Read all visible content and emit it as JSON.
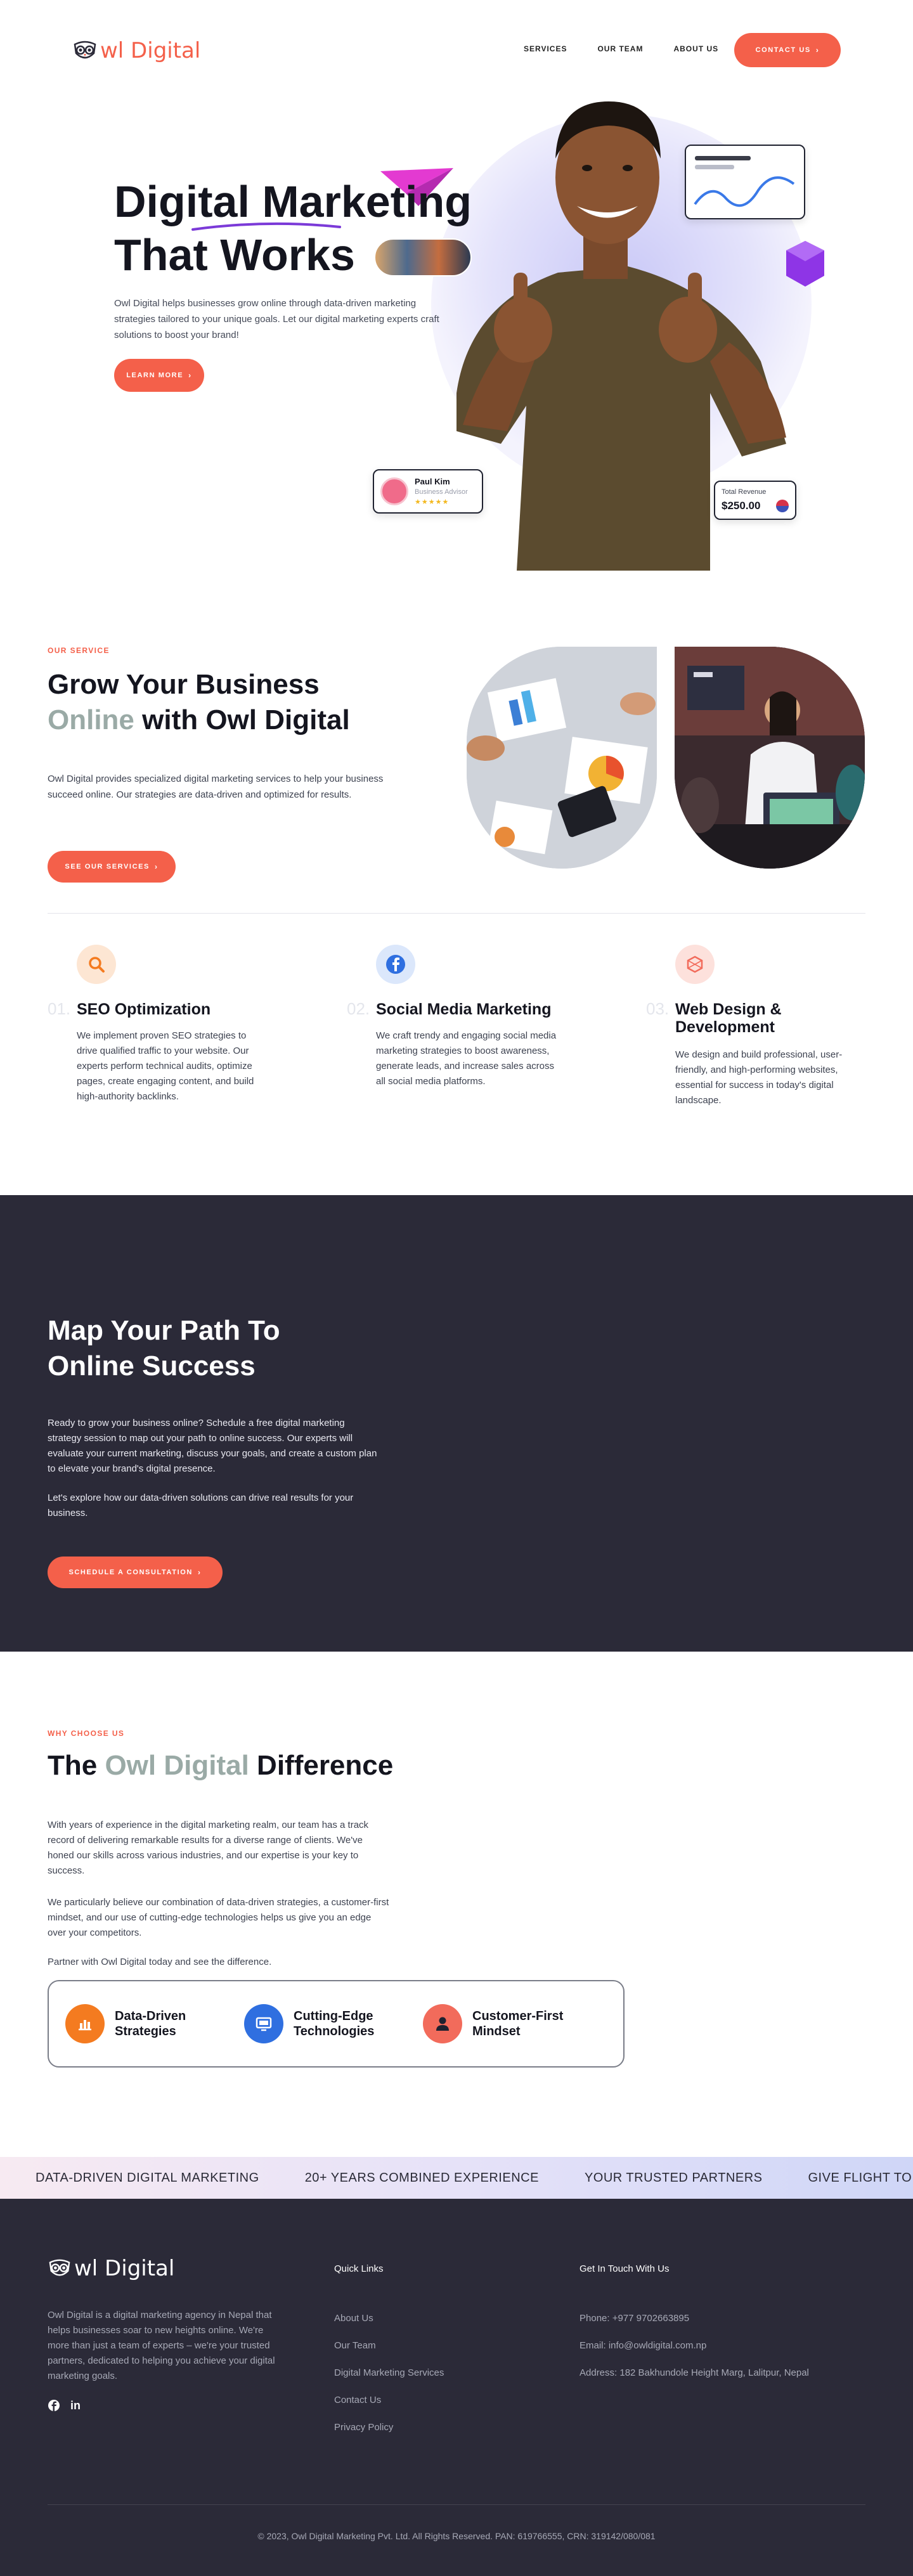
{
  "brand": {
    "name": "wl Digital",
    "accent": "#f4604a",
    "dark": "#2b2a38"
  },
  "nav": {
    "items": [
      "SERVICES",
      "OUR TEAM",
      "ABOUT US"
    ],
    "contact": "CONTACT US"
  },
  "hero": {
    "title_line1": "Digital Marketing",
    "title_line2": "That Works",
    "description": "Owl Digital helps businesses grow online through data-driven marketing strategies tailored to your unique goals. Let our digital marketing experts craft solutions to boost your brand!",
    "cta": "LEARN MORE",
    "person_card": {
      "name": "Paul Kim",
      "role": "Business Advisor",
      "stars": "★★★★★"
    },
    "revenue_card": {
      "label": "Total Revenue",
      "value": "$250.00"
    }
  },
  "services": {
    "eyebrow": "OUR SERVICE",
    "title_line1": "Grow Your Business",
    "title_muted": "Online",
    "title_rest": " with Owl Digital",
    "description": "Owl Digital provides specialized digital marketing services to help your business succeed online. Our strategies are data-driven and optimized for results.",
    "cta": "SEE OUR SERVICES",
    "items": [
      {
        "num": "01.",
        "title": "SEO Optimization",
        "desc": "We implement proven SEO strategies to drive qualified traffic to your website. Our experts perform technical audits, optimize pages, create engaging content, and build high-authority backlinks.",
        "icon": "search-icon"
      },
      {
        "num": "02.",
        "title": "Social Media Marketing",
        "desc": "We craft trendy and engaging social media marketing strategies to boost awareness, generate leads, and increase sales across all social media platforms.",
        "icon": "facebook-icon"
      },
      {
        "num": "03.",
        "title": "Web Design & Development",
        "desc": "We design and build professional, user-friendly, and high-performing websites, essential for success in today's digital landscape.",
        "icon": "web-design-icon"
      }
    ]
  },
  "path": {
    "title_line1": "Map Your Path To",
    "title_line2": "Online Success",
    "para1": "Ready to grow your business online? Schedule a free digital marketing strategy session to map out your path to online success. Our experts will evaluate your current marketing, discuss your goals, and create a custom plan to elevate your brand's digital presence.",
    "para2": "Let's explore how our data-driven solutions can drive real results for your business.",
    "cta": "SCHEDULE A CONSULTATION"
  },
  "why": {
    "eyebrow": "WHY CHOOSE US",
    "title_pre": "The ",
    "title_muted": "Owl Digital",
    "title_post": " Difference",
    "para1": "With years of experience in the digital marketing realm, our team has a track record of delivering remarkable results for a diverse range of clients. We've honed our skills across various industries, and our expertise is your key to success.",
    "para2": "We particularly believe our combination of data-driven strategies, a customer-first mindset, and our use of cutting-edge technologies helps us give you an edge over your competitors.",
    "para3": "Partner with Owl Digital today and see the difference.",
    "features": [
      {
        "label": "Data-Driven Strategies",
        "icon": "bar-chart-icon",
        "color": "#f47b20"
      },
      {
        "label": "Cutting-Edge Technologies",
        "icon": "monitor-icon",
        "color": "#2f6fe0"
      },
      {
        "label": "Customer-First Mindset",
        "icon": "user-icon",
        "color": "#f26b5b"
      }
    ]
  },
  "ticker": [
    "DATA-DRIVEN DIGITAL MARKETING",
    "20+ YEARS COMBINED EXPERIENCE",
    "YOUR TRUSTED PARTNERS",
    "GIVE FLIGHT TO YOU"
  ],
  "footer": {
    "logo": "wl Digital",
    "about": "Owl Digital is a digital marketing agency in Nepal that helps businesses soar to new heights online. We're more than just a team of experts – we're your trusted partners, dedicated to helping you achieve your digital marketing goals.",
    "quick_links_title": "Quick Links",
    "quick_links": [
      "About Us",
      "Our Team",
      "Digital Marketing Services",
      "Contact Us",
      "Privacy Policy"
    ],
    "contact_title": "Get In Touch With Us",
    "contact": [
      "Phone: +977 9702663895",
      "Email: info@owldigital.com.np",
      "Address: 182 Bakhundole Height Marg, Lalitpur, Nepal"
    ],
    "copyright": "© 2023, Owl Digital Marketing Pvt. Ltd. All Rights Reserved. PAN: 619766555, CRN: 319142/080/081"
  }
}
